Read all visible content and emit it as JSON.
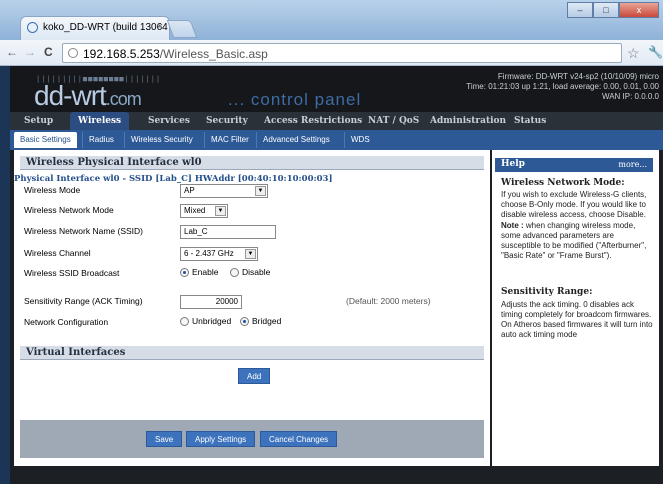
{
  "browser": {
    "tab_title": "koko_DD-WRT (build 13064",
    "tab_close": "×",
    "nav_back": "←",
    "nav_forward": "→",
    "nav_reload": "C",
    "address_host": "192.168.5.253",
    "address_path": "/Wireless_Basic.asp",
    "star": "☆",
    "wrench": "🔧",
    "minimize": "–",
    "maximize": "□",
    "close": "x"
  },
  "header": {
    "logo_text": "dd-wrt",
    "logo_com": ".com",
    "control_panel": "... control panel",
    "firmware": "Firmware: DD-WRT v24-sp2 (10/10/09) micro",
    "time": "Time: 01:21:03 up 1:21, load average: 0.00, 0.01, 0.00",
    "wan_ip": "WAN IP: 0.0.0.0"
  },
  "menu": [
    "Setup",
    "Wireless",
    "Services",
    "Security",
    "Access Restrictions",
    "NAT / QoS",
    "Administration",
    "Status"
  ],
  "submenu": [
    "Basic Settings",
    "Radius",
    "Wireless Security",
    "MAC Filter",
    "Advanced Settings",
    "WDS"
  ],
  "main": {
    "section_title": "Wireless Physical Interface wl0",
    "interface_title": "Physical Interface wl0 - SSID [Lab_C] HWAddr [00:40:10:10:00:03]",
    "wireless_mode_label": "Wireless Mode",
    "wireless_mode_value": "AP",
    "network_mode_label": "Wireless Network Mode",
    "network_mode_value": "Mixed",
    "ssid_label": "Wireless Network Name (SSID)",
    "ssid_value": "Lab_C",
    "channel_label": "Wireless Channel",
    "channel_value": "6 - 2.437 GHz",
    "broadcast_label": "Wireless SSID Broadcast",
    "enable": "Enable",
    "disable": "Disable",
    "sensitivity_label": "Sensitivity Range (ACK Timing)",
    "sensitivity_value": "20000",
    "sensitivity_default": "(Default: 2000 meters)",
    "netconfig_label": "Network Configuration",
    "unbridged": "Unbridged",
    "bridged": "Bridged",
    "virtual_title": "Virtual Interfaces",
    "add_button": "Add",
    "save_button": "Save",
    "apply_button": "Apply Settings",
    "cancel_button": "Cancel Changes"
  },
  "help": {
    "title": "Help",
    "more": "more...",
    "mode_title": "Wireless Network Mode:",
    "mode_text_1": "If you wish to exclude Wireless-G clients, choose B-Only mode. If you would like to disable wireless access, choose Disable.",
    "mode_note_label": "Note :",
    "mode_text_2": "when changing wireless mode, some advanced parameters are susceptible to be modified (\"Afterburner\", \"Basic Rate\" or \"Frame Burst\").",
    "sens_title": "Sensitivity Range:",
    "sens_text": "Adjusts the ack timing. 0 disables ack timing completely for broadcom firmwares. On Atheros based firmwares it will turn into auto ack timing mode"
  }
}
